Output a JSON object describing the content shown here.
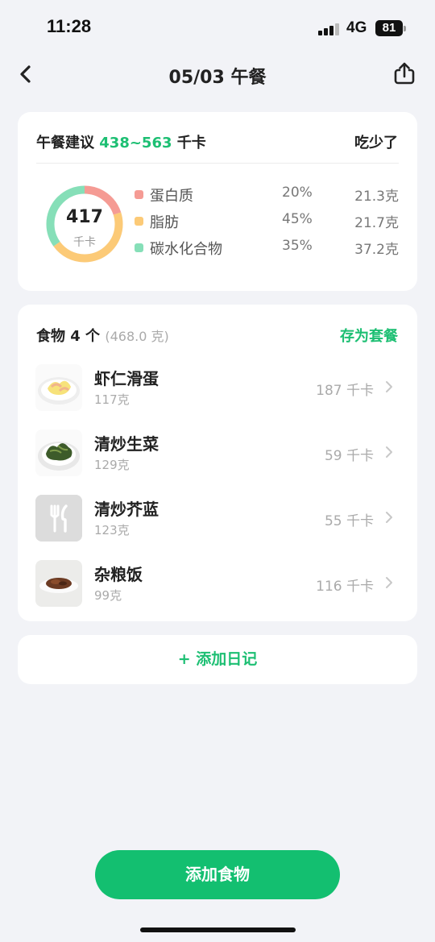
{
  "status_bar": {
    "time": "11:28",
    "network": "4G",
    "battery": "81"
  },
  "nav": {
    "title": "05/03 午餐"
  },
  "summary": {
    "label_prefix": "午餐建议",
    "range": "438~563",
    "unit": "千卡",
    "status": "吃少了",
    "calories": "417",
    "calories_unit": "千卡",
    "macros": [
      {
        "name": "蛋白质",
        "percent": "20%",
        "amount": "21.3克",
        "color": "#f59b94",
        "fraction": 0.2
      },
      {
        "name": "脂肪",
        "percent": "45%",
        "amount": "21.7克",
        "color": "#fcca77",
        "fraction": 0.45
      },
      {
        "name": "碳水化合物",
        "percent": "35%",
        "amount": "37.2克",
        "color": "#86dfb8",
        "fraction": 0.35
      }
    ]
  },
  "foods": {
    "title": "食物 4 个",
    "total_weight": "(468.0 克)",
    "save_label": "存为套餐",
    "items": [
      {
        "name": "虾仁滑蛋",
        "weight": "117克",
        "kcal": "187 千卡",
        "thumb": "shrimp-egg-thumb"
      },
      {
        "name": "清炒生菜",
        "weight": "129克",
        "kcal": "59 千卡",
        "thumb": "lettuce-thumb"
      },
      {
        "name": "清炒芥蓝",
        "weight": "123克",
        "kcal": "55 千卡",
        "thumb": "fork-knife-icon"
      },
      {
        "name": "杂粮饭",
        "weight": "99克",
        "kcal": "116 千卡",
        "thumb": "rice-thumb"
      }
    ]
  },
  "add_diary_label": "+ 添加日记",
  "add_food_label": "添加食物"
}
